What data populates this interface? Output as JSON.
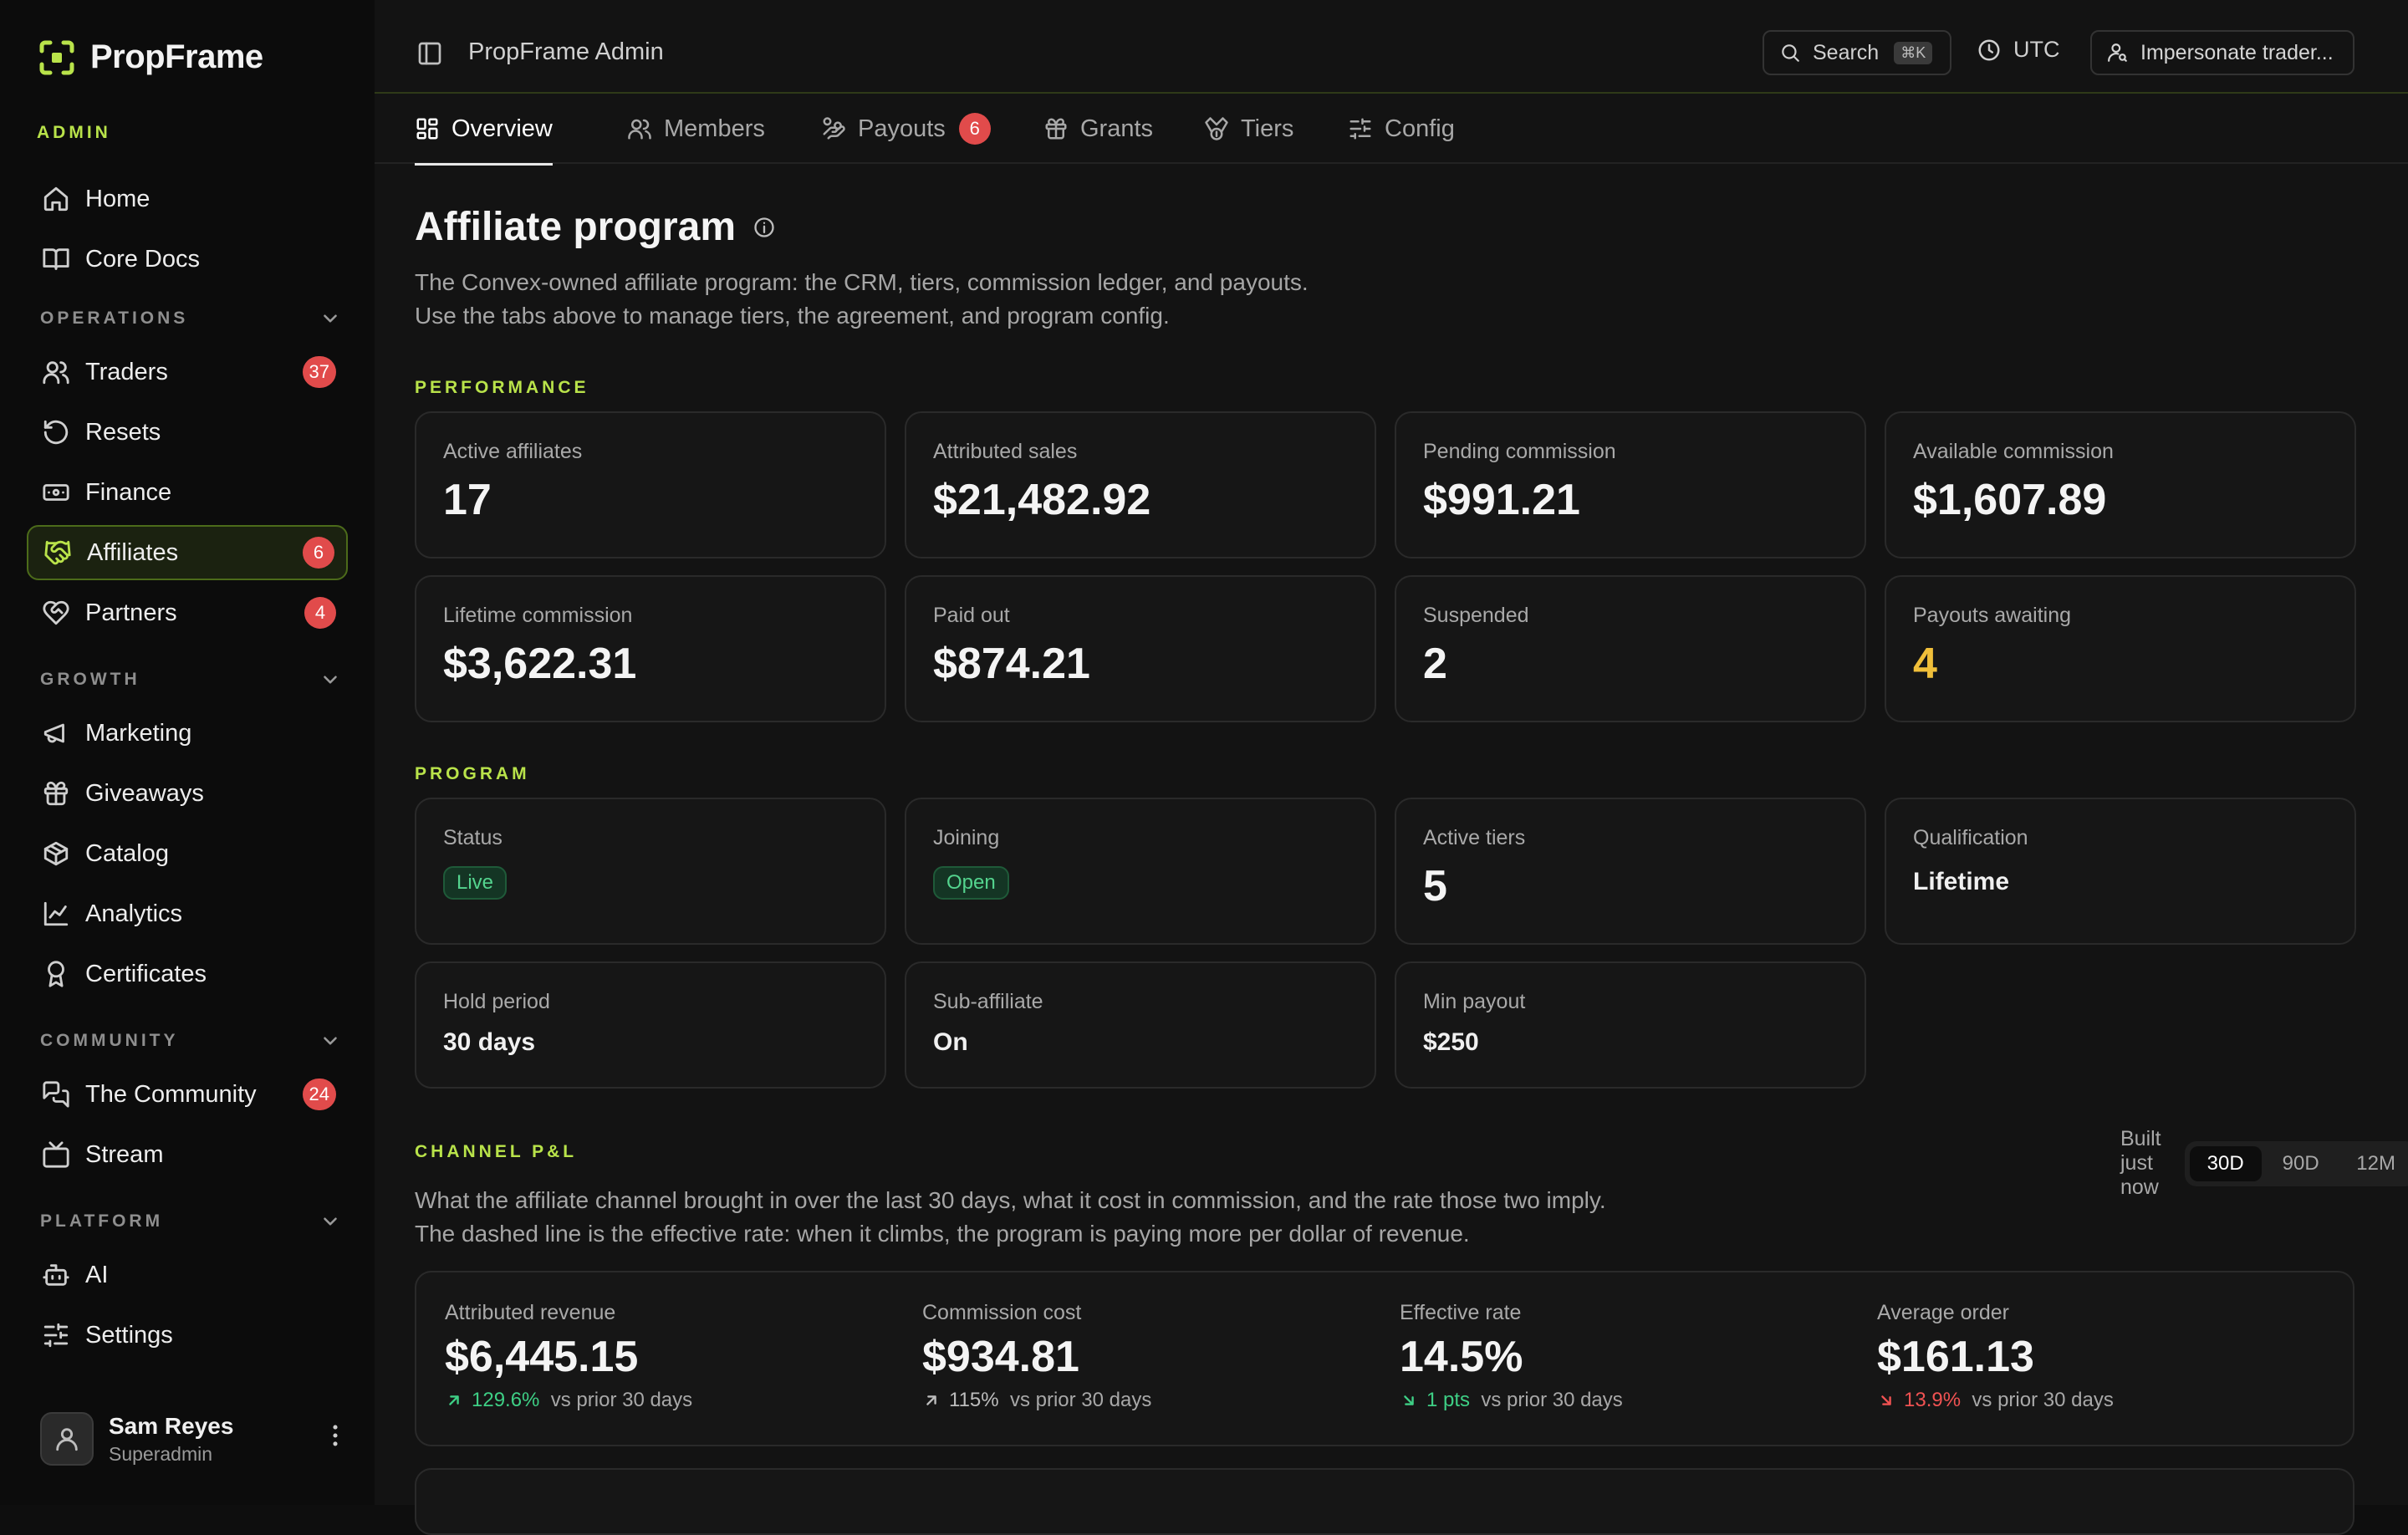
{
  "brand": {
    "name": "PropFrame",
    "section": "ADMIN"
  },
  "sidebar": {
    "top_items": [
      {
        "label": "Home",
        "icon": "home-icon"
      },
      {
        "label": "Core Docs",
        "icon": "book-icon"
      }
    ],
    "sections": [
      {
        "title": "OPERATIONS",
        "items": [
          {
            "label": "Traders",
            "icon": "users-icon",
            "badge": "37"
          },
          {
            "label": "Resets",
            "icon": "rotate-icon",
            "badge": null
          },
          {
            "label": "Finance",
            "icon": "banknote-icon",
            "badge": null
          },
          {
            "label": "Affiliates",
            "icon": "handshake-icon",
            "badge": "6",
            "active": true
          },
          {
            "label": "Partners",
            "icon": "heart-handshake-icon",
            "badge": "4"
          }
        ]
      },
      {
        "title": "GROWTH",
        "items": [
          {
            "label": "Marketing",
            "icon": "megaphone-icon"
          },
          {
            "label": "Giveaways",
            "icon": "gift-icon"
          },
          {
            "label": "Catalog",
            "icon": "package-icon"
          },
          {
            "label": "Analytics",
            "icon": "chart-line-icon"
          },
          {
            "label": "Certificates",
            "icon": "award-icon"
          }
        ]
      },
      {
        "title": "COMMUNITY",
        "items": [
          {
            "label": "The Community",
            "icon": "messages-icon",
            "badge": "24"
          },
          {
            "label": "Stream",
            "icon": "tv-icon"
          }
        ]
      },
      {
        "title": "PLATFORM",
        "items": [
          {
            "label": "AI",
            "icon": "bot-icon"
          },
          {
            "label": "Settings",
            "icon": "sliders-icon"
          }
        ]
      }
    ],
    "user": {
      "name": "Sam Reyes",
      "role": "Superadmin"
    }
  },
  "topbar": {
    "title": "PropFrame Admin",
    "search_label": "Search",
    "search_shortcut": "⌘K",
    "timezone": "UTC",
    "impersonate_label": "Impersonate trader..."
  },
  "tabs": [
    {
      "label": "Overview",
      "icon": "layout-dashboard-icon",
      "active": true
    },
    {
      "label": "Members",
      "icon": "users-icon"
    },
    {
      "label": "Payouts",
      "icon": "hand-coins-icon",
      "badge": "6"
    },
    {
      "label": "Grants",
      "icon": "gift-icon"
    },
    {
      "label": "Tiers",
      "icon": "medal-icon"
    },
    {
      "label": "Config",
      "icon": "sliders-icon"
    }
  ],
  "page": {
    "title": "Affiliate program",
    "desc_line1": "The Convex-owned affiliate program: the CRM, tiers, commission ledger, and payouts.",
    "desc_line2": "Use the tabs above to manage tiers, the agreement, and program config."
  },
  "performance": {
    "label": "PERFORMANCE",
    "cards": [
      {
        "label": "Active affiliates",
        "value": "17"
      },
      {
        "label": "Attributed sales",
        "value": "$21,482.92"
      },
      {
        "label": "Pending commission",
        "value": "$991.21"
      },
      {
        "label": "Available commission",
        "value": "$1,607.89"
      },
      {
        "label": "Lifetime commission",
        "value": "$3,622.31"
      },
      {
        "label": "Paid out",
        "value": "$874.21"
      },
      {
        "label": "Suspended",
        "value": "2"
      },
      {
        "label": "Payouts awaiting",
        "value": "4",
        "highlight_color": "#f0bf3a"
      }
    ]
  },
  "program": {
    "label": "PROGRAM",
    "status": {
      "label": "Status",
      "value": "Live"
    },
    "joining": {
      "label": "Joining",
      "value": "Open"
    },
    "active_tiers": {
      "label": "Active tiers",
      "value": "5"
    },
    "qualification": {
      "label": "Qualification",
      "value": "Lifetime"
    },
    "hold_period": {
      "label": "Hold period",
      "value": "30 days"
    },
    "sub_affiliate": {
      "label": "Sub-affiliate",
      "value": "On"
    },
    "min_payout": {
      "label": "Min payout",
      "value": "$250"
    }
  },
  "channel": {
    "label": "CHANNEL P&L",
    "built": "Built just now",
    "ranges": [
      "30D",
      "90D",
      "12M"
    ],
    "selected_range": "30D",
    "desc_line1": "What the affiliate channel brought in over the last 30 days, what it cost in commission, and the rate those two imply.",
    "desc_line2": "The dashed line is the effective rate: when it climbs, the program is paying more per dollar of revenue.",
    "metrics": [
      {
        "label": "Attributed revenue",
        "value": "$6,445.15",
        "delta": "129.6%",
        "trend": "up-good",
        "suffix": "vs prior 30 days"
      },
      {
        "label": "Commission cost",
        "value": "$934.81",
        "delta": "115%",
        "trend": "up-neutral",
        "suffix": "vs prior 30 days"
      },
      {
        "label": "Effective rate",
        "value": "14.5%",
        "delta": "1 pts",
        "trend": "down-good",
        "suffix": "vs prior 30 days"
      },
      {
        "label": "Average order",
        "value": "$161.13",
        "delta": "13.9%",
        "trend": "down-bad",
        "suffix": "vs prior 30 days"
      }
    ]
  },
  "colors": {
    "accent": "#b9e34a",
    "badge": "#e14b4b",
    "positive": "#3ecf85",
    "negative": "#f05252",
    "warning": "#f0bf3a"
  }
}
